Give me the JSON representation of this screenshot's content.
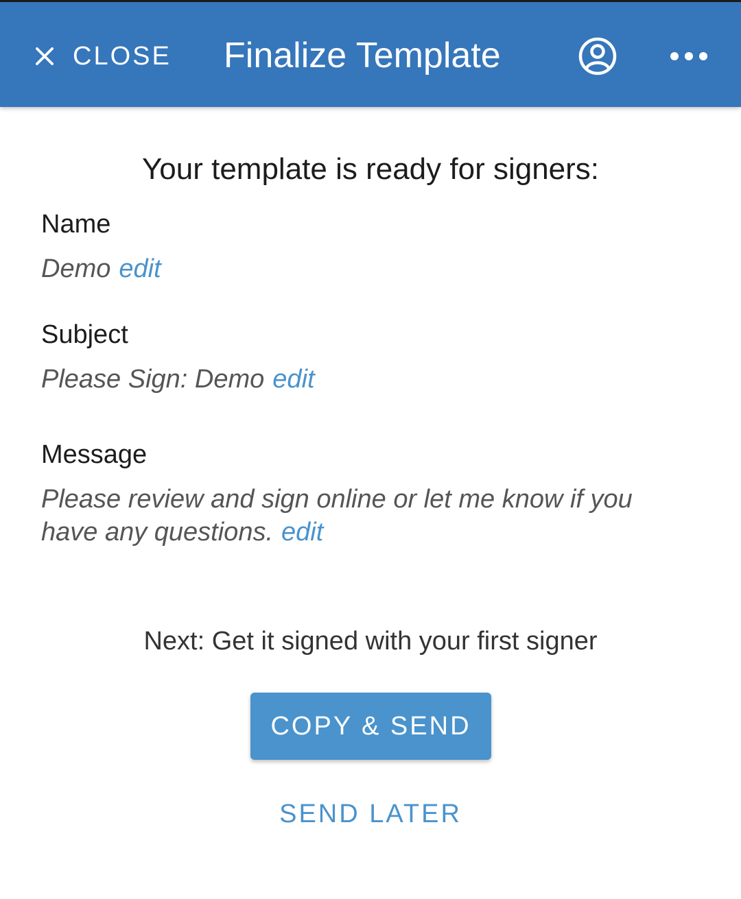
{
  "header": {
    "close_label": "CLOSE",
    "title": "Finalize Template",
    "close_icon": "close-icon",
    "account_icon": "account-circle-icon",
    "more_icon": "more-horizontal-icon"
  },
  "main": {
    "heading": "Your template is ready for signers:",
    "fields": [
      {
        "label": "Name",
        "value": "Demo",
        "edit_label": "edit"
      },
      {
        "label": "Subject",
        "value": "Please Sign: Demo",
        "edit_label": "edit"
      },
      {
        "label": "Message",
        "value": "Please review and sign online or let me know if you have any questions.",
        "edit_label": "edit"
      }
    ],
    "next_text": "Next: Get it signed with your first signer",
    "primary_button": "COPY & SEND",
    "secondary_button": "SEND LATER"
  },
  "colors": {
    "header_bg": "#3676bb",
    "accent": "#4a93cc"
  }
}
